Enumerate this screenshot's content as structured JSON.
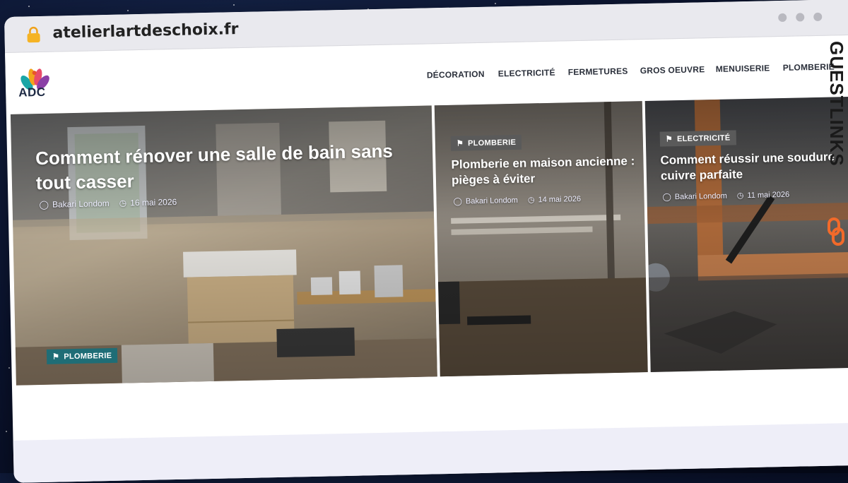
{
  "browser": {
    "url": "atelierlartdeschoix.fr"
  },
  "site": {
    "logo_text": "ADC",
    "nav": [
      "DÉCORATION",
      "ELECTRICITÉ",
      "FERMETURES",
      "GROS OEUVRE",
      "MENUISERIE",
      "PLOMBERIE"
    ]
  },
  "articles": [
    {
      "title": "Comment rénover une salle de bain sans tout casser",
      "author": "Bakari Londom",
      "date": "16 mai 2026",
      "category": "PLOMBERIE"
    },
    {
      "title": "Plomberie en maison ancienne : pièges à éviter",
      "author": "Bakari Londom",
      "date": "14 mai 2026",
      "category": "PLOMBERIE"
    },
    {
      "title": "Comment réussir une soudure cuivre parfaite",
      "author": "Bakari Londom",
      "date": "11 mai 2026",
      "category": "ELECTRICITÉ"
    }
  ],
  "brand_overlay": "GUESTLINKS",
  "colors": {
    "badge_teal": "#1f6d76",
    "badge_gray": "#5a5a5a",
    "brand_orange": "#f26a2a"
  }
}
